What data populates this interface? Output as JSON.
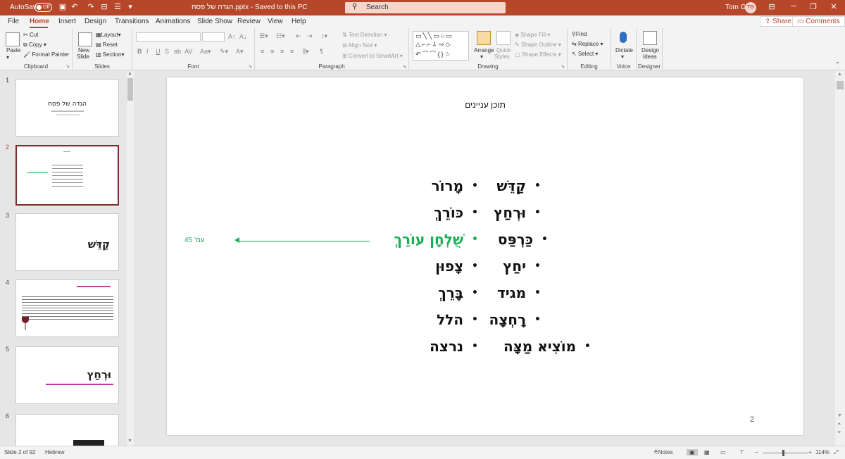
{
  "titlebar": {
    "autosave_label": "AutoSave",
    "autosave_state": "Off",
    "doc_title": "הגדה של פסח.pptx  -  Saved to this PC",
    "search_placeholder": "Search",
    "user_name": "Tom G",
    "user_initials": "TG"
  },
  "tabs": [
    "File",
    "Home",
    "Insert",
    "Design",
    "Transitions",
    "Animations",
    "Slide Show",
    "Review",
    "View",
    "Help"
  ],
  "active_tab": "Home",
  "share_label": "Share",
  "comments_label": "Comments",
  "ribbon": {
    "clipboard": {
      "label": "Clipboard",
      "paste": "Paste",
      "cut": "Cut",
      "copy": "Copy",
      "format_painter": "Format Painter"
    },
    "slides": {
      "label": "Slides",
      "new_slide_1": "New",
      "new_slide_2": "Slide",
      "layout": "Layout",
      "reset": "Reset",
      "section": "Section"
    },
    "font": {
      "label": "Font"
    },
    "paragraph": {
      "label": "Paragraph",
      "text_direction": "Text Direction",
      "align_text": "Align Text",
      "convert_smartart": "Convert to SmartArt"
    },
    "drawing": {
      "label": "Drawing",
      "arrange": "Arrange",
      "quick_styles_1": "Quick",
      "quick_styles_2": "Styles",
      "shape_fill": "Shape Fill",
      "shape_outline": "Shape Outline",
      "shape_effects": "Shape Effects"
    },
    "editing": {
      "label": "Editing",
      "find": "Find",
      "replace": "Replace",
      "select": "Select"
    },
    "voice": {
      "label": "Voice",
      "dictate": "Dictate"
    },
    "designer": {
      "label": "Designer",
      "design_ideas_1": "Design",
      "design_ideas_2": "Ideas"
    }
  },
  "thumbnails": [
    {
      "num": "1",
      "title": "הגדה של פסח"
    },
    {
      "num": "2",
      "title": ""
    },
    {
      "num": "3",
      "title": "קַדֵּשׁ"
    },
    {
      "num": "4",
      "title": ""
    },
    {
      "num": "5",
      "title": "וּרְחַץ"
    },
    {
      "num": "6",
      "title": ""
    }
  ],
  "slide": {
    "title": "תוכן עניינים",
    "right_column": [
      "קַדֵּשׁ",
      "וּרְחַץ",
      "כַּרְפַּס",
      "יחַץ",
      "מגיד",
      "רָחְצָה",
      "מוֹצִיא מַצָּה"
    ],
    "left_column": [
      "מָרוֹר",
      "כּוֹרֵךְ",
      "שֻׁלְחָן עוֹרֵךְ",
      "צָפוּן",
      "בָּרֵךְ",
      "הלל",
      "נרצה"
    ],
    "highlight_index": 2,
    "highlight_color": "#1aae55",
    "annotation": "עמ' 45",
    "slide_number": "2"
  },
  "status": {
    "slide_info": "Slide 2 of 92",
    "language": "Hebrew",
    "notes": "Notes",
    "zoom": "114%"
  }
}
